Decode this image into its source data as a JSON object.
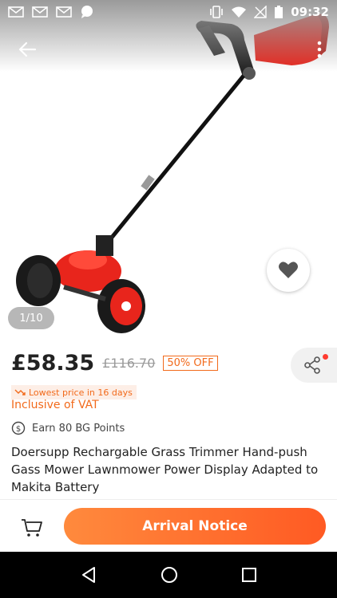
{
  "status_bar": {
    "time": "09:32"
  },
  "gallery": {
    "counter": "1/10"
  },
  "product": {
    "price": "£58.35",
    "original_price": "£116.70",
    "discount": "50% OFF",
    "lowest_price_note": "Lowest price in 16 days",
    "vat_note": "Inclusive of VAT",
    "points": "Earn 80 BG Points",
    "title": "Doersupp Rechargable Grass Trimmer Hand-push Gass Mower Lawnmower Power Display Adapted to Makita Battery"
  },
  "actions": {
    "primary_label": "Arrival Notice"
  },
  "colors": {
    "accent": "#f26a1b",
    "button_start": "#ff8a3d",
    "button_end": "#ff5a23",
    "product_red": "#e8251c"
  }
}
